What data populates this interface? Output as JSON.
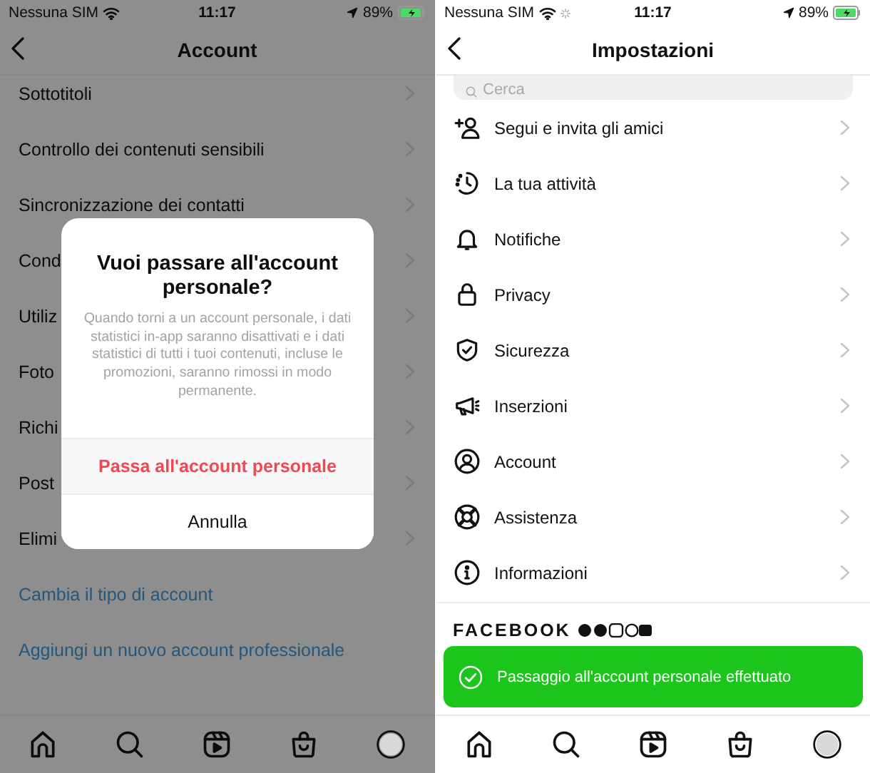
{
  "left_screen": {
    "status_bar": {
      "carrier": "Nessuna SIM",
      "time": "11:17",
      "battery": "89%"
    },
    "header": {
      "title": "Account"
    },
    "items": [
      {
        "kind": "row",
        "label": "Sottotitoli"
      },
      {
        "kind": "row",
        "label": "Controllo dei contenuti sensibili"
      },
      {
        "kind": "row",
        "label": "Sincronizzazione dei contatti"
      },
      {
        "kind": "row",
        "label": "Cond"
      },
      {
        "kind": "row",
        "label": "Utiliz"
      },
      {
        "kind": "row",
        "label": "Foto"
      },
      {
        "kind": "row",
        "label": "Richi"
      },
      {
        "kind": "row",
        "label": "Post"
      },
      {
        "kind": "row",
        "label": "Elimi"
      },
      {
        "kind": "link",
        "label": "Cambia il tipo di account"
      },
      {
        "kind": "link",
        "label": "Aggiungi un nuovo account professionale"
      }
    ],
    "dialog": {
      "title": "Vuoi passare all'account personale?",
      "message": "Quando torni a un account personale, i dati statistici in-app saranno disattivati e i dati statistici di tutti i tuoi contenuti, incluse le promozioni, saranno rimossi in modo permanente.",
      "buttons": [
        {
          "kind": "destructive",
          "label": "Passa all'account personale"
        },
        {
          "kind": "cancel",
          "label": "Annulla"
        }
      ]
    }
  },
  "right_screen": {
    "status_bar": {
      "carrier": "Nessuna SIM",
      "time": "11:17",
      "battery": "89%"
    },
    "header": {
      "title": "Impostazioni"
    },
    "search": {
      "placeholder": "Cerca"
    },
    "items": [
      {
        "label": "Segui e invita gli amici"
      },
      {
        "label": "La tua attività"
      },
      {
        "label": "Notifiche"
      },
      {
        "label": "Privacy"
      },
      {
        "label": "Sicurezza"
      },
      {
        "label": "Inserzioni"
      },
      {
        "label": "Account"
      },
      {
        "label": "Assistenza"
      },
      {
        "label": "Informazioni"
      }
    ],
    "footer": {
      "title": "FACEBOOK"
    },
    "toast": {
      "message": "Passaggio all'account personale effettuato"
    }
  }
}
